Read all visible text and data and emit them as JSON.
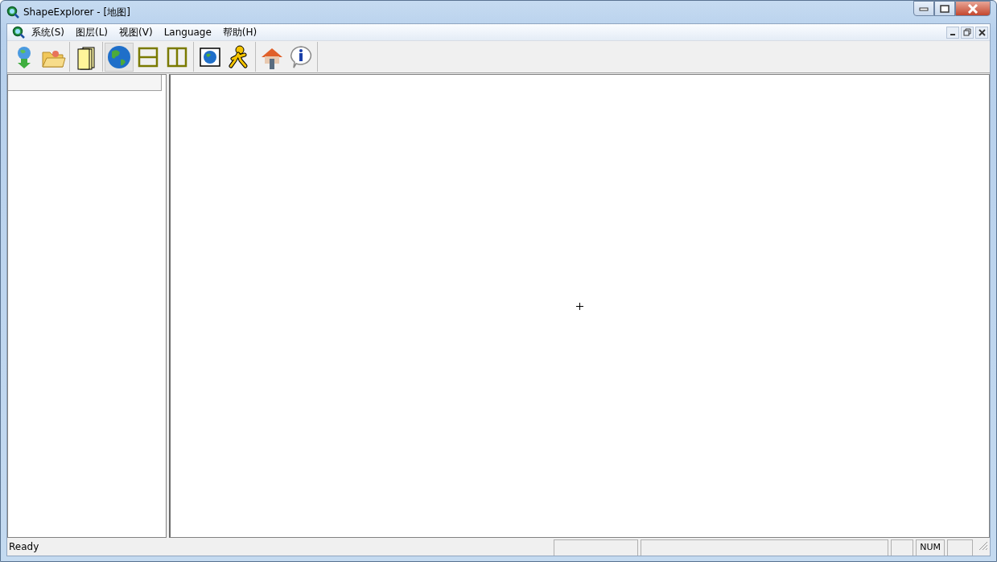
{
  "window": {
    "title": "ShapeExplorer - [地图]"
  },
  "menu": [
    {
      "label": "系统(S)"
    },
    {
      "label": "图层(L)"
    },
    {
      "label": "视图(V)"
    },
    {
      "label": "Language"
    },
    {
      "label": "帮助(H)"
    }
  ],
  "toolbar": {
    "groups": [
      [
        {
          "kind": "import",
          "selected": false
        },
        {
          "kind": "open",
          "selected": false
        }
      ],
      [
        {
          "kind": "pages",
          "selected": false
        }
      ],
      [
        {
          "kind": "globe",
          "selected": true
        },
        {
          "kind": "hsplit",
          "selected": false
        },
        {
          "kind": "vsplit",
          "selected": false
        }
      ],
      [
        {
          "kind": "framedglobe",
          "selected": false
        },
        {
          "kind": "runner",
          "selected": false
        }
      ],
      [
        {
          "kind": "house",
          "selected": false
        },
        {
          "kind": "info",
          "selected": false
        }
      ]
    ]
  },
  "status_bar": {
    "message": "Ready",
    "indicators": [
      "NUM"
    ]
  }
}
